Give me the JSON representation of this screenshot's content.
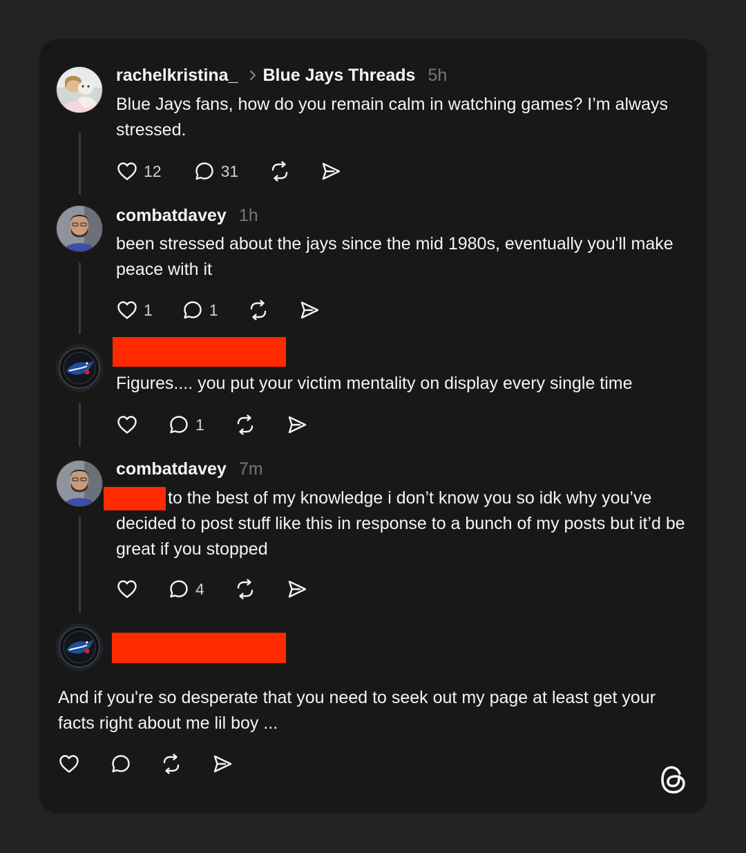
{
  "posts": [
    {
      "username": "rachelkristina_",
      "community": "Blue Jays Threads",
      "time": "5h",
      "text": "Blue Jays fans, how do you remain calm in watching games? I’m always stressed.",
      "likes": "12",
      "replies": "31"
    },
    {
      "username": "combatdavey",
      "time": "1h",
      "text": "been stressed about the jays since the mid 1980s, eventually you'll make peace with it",
      "likes": "1",
      "replies": "1"
    },
    {
      "username": "",
      "time": "",
      "text": "Figures.... you put your victim mentality on display every single time",
      "likes": "",
      "replies": "1"
    },
    {
      "username": "combatdavey",
      "time": "7m",
      "text": "to the best of my knowledge i don’t know you so idk why you’ve decided to post stuff like this in response to a bunch of my posts but it’d be great if you stopped",
      "likes": "",
      "replies": "4"
    },
    {
      "username": "",
      "time": "",
      "text": "And if you're so desperate that you need to seek out my page at least get your facts right about me lil boy ...",
      "likes": "",
      "replies": ""
    }
  ],
  "colors": {
    "background": "#232323",
    "card": "#181818",
    "text": "#f3f5f7",
    "muted": "#777777",
    "redaction": "#ff2a00"
  },
  "icons": [
    "heart-icon",
    "comment-icon",
    "repost-icon",
    "share-icon",
    "threads-logo-icon"
  ]
}
